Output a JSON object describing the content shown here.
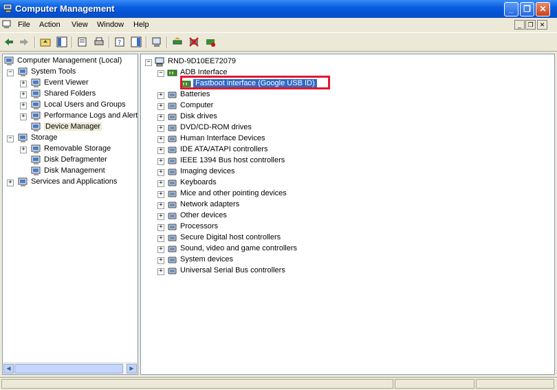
{
  "window": {
    "title": "Computer Management"
  },
  "menu": {
    "items": [
      "File",
      "Action",
      "View",
      "Window",
      "Help"
    ]
  },
  "left_tree": [
    {
      "label": "Computer Management (Local)",
      "level": 0,
      "expander": "",
      "icon": "computer-management-icon"
    },
    {
      "label": "System Tools",
      "level": 1,
      "expander": "−",
      "icon": "system-tools-icon"
    },
    {
      "label": "Event Viewer",
      "level": 2,
      "expander": "+",
      "icon": "event-viewer-icon"
    },
    {
      "label": "Shared Folders",
      "level": 2,
      "expander": "+",
      "icon": "shared-folders-icon"
    },
    {
      "label": "Local Users and Groups",
      "level": 2,
      "expander": "+",
      "icon": "users-icon"
    },
    {
      "label": "Performance Logs and Alerts",
      "level": 2,
      "expander": "+",
      "icon": "performance-icon"
    },
    {
      "label": "Device Manager",
      "level": 2,
      "expander": "",
      "icon": "device-manager-icon",
      "selected": true
    },
    {
      "label": "Storage",
      "level": 1,
      "expander": "−",
      "icon": "storage-icon"
    },
    {
      "label": "Removable Storage",
      "level": 2,
      "expander": "+",
      "icon": "removable-storage-icon"
    },
    {
      "label": "Disk Defragmenter",
      "level": 2,
      "expander": "",
      "icon": "defragmenter-icon"
    },
    {
      "label": "Disk Management",
      "level": 2,
      "expander": "",
      "icon": "disk-management-icon"
    },
    {
      "label": "Services and Applications",
      "level": 1,
      "expander": "+",
      "icon": "services-icon"
    }
  ],
  "device_tree": {
    "root": "RND-9D10EE72079",
    "adb_group": "ADB Interface",
    "adb_child": "Fastboot interface (Google USB ID)",
    "categories": [
      {
        "label": "Batteries",
        "icon": "battery-icon"
      },
      {
        "label": "Computer",
        "icon": "computer-icon"
      },
      {
        "label": "Disk drives",
        "icon": "disk-drive-icon"
      },
      {
        "label": "DVD/CD-ROM drives",
        "icon": "dvd-drive-icon"
      },
      {
        "label": "Human Interface Devices",
        "icon": "hid-icon"
      },
      {
        "label": "IDE ATA/ATAPI controllers",
        "icon": "ide-controller-icon"
      },
      {
        "label": "IEEE 1394 Bus host controllers",
        "icon": "ieee1394-icon"
      },
      {
        "label": "Imaging devices",
        "icon": "imaging-icon"
      },
      {
        "label": "Keyboards",
        "icon": "keyboard-icon"
      },
      {
        "label": "Mice and other pointing devices",
        "icon": "mouse-icon"
      },
      {
        "label": "Network adapters",
        "icon": "network-adapter-icon"
      },
      {
        "label": "Other devices",
        "icon": "other-devices-icon"
      },
      {
        "label": "Processors",
        "icon": "processor-icon"
      },
      {
        "label": "Secure Digital host controllers",
        "icon": "sd-controller-icon"
      },
      {
        "label": "Sound, video and game controllers",
        "icon": "sound-icon"
      },
      {
        "label": "System devices",
        "icon": "system-devices-icon"
      },
      {
        "label": "Universal Serial Bus controllers",
        "icon": "usb-icon"
      }
    ]
  },
  "colors": {
    "titlebar": "#0553d6",
    "selection": "#316ac5",
    "highlight_box": "#e3162b"
  }
}
